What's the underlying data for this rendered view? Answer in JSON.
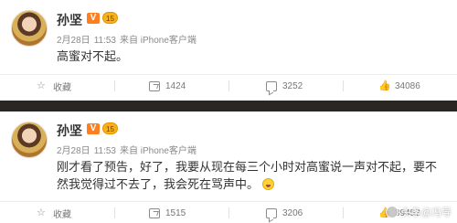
{
  "posts": [
    {
      "author": "孙坚",
      "vip_mark": "V",
      "badge": "15",
      "date": "2月28日",
      "time": "11:53",
      "source": "来自 iPhone客户端",
      "text": "高蜜对不起。",
      "actions": {
        "favorite": "收藏",
        "share": "1424",
        "comment": "3252",
        "like": "34086"
      }
    },
    {
      "author": "孙坚",
      "vip_mark": "V",
      "badge": "15",
      "date": "2月28日",
      "time": "11:53",
      "source": "来自 iPhone客户端",
      "text": "刚才看了预告，好了，我要从现在每三个小时对高蜜说一声对不起，要不然我觉得过不去了，我会死在骂声中。",
      "actions": {
        "favorite": "收藏",
        "share": "1515",
        "comment": "3206",
        "like": "39452"
      }
    }
  ],
  "icons": {
    "avatar": "avatar-image",
    "verified": "v-verified-icon",
    "badge": "member-badge-icon",
    "favorite": "star-icon",
    "share": "share-icon",
    "comment": "comment-icon",
    "like": "thumbs-up-icon",
    "emoji": "laughing-emoji-icon"
  },
  "watermark": "头条@冯导",
  "colors": {
    "divider": "#2a2624",
    "vip": "#ff7e20",
    "badge": "#f7b21a",
    "meta_text": "#8a8a8a",
    "body_text": "#333333"
  }
}
